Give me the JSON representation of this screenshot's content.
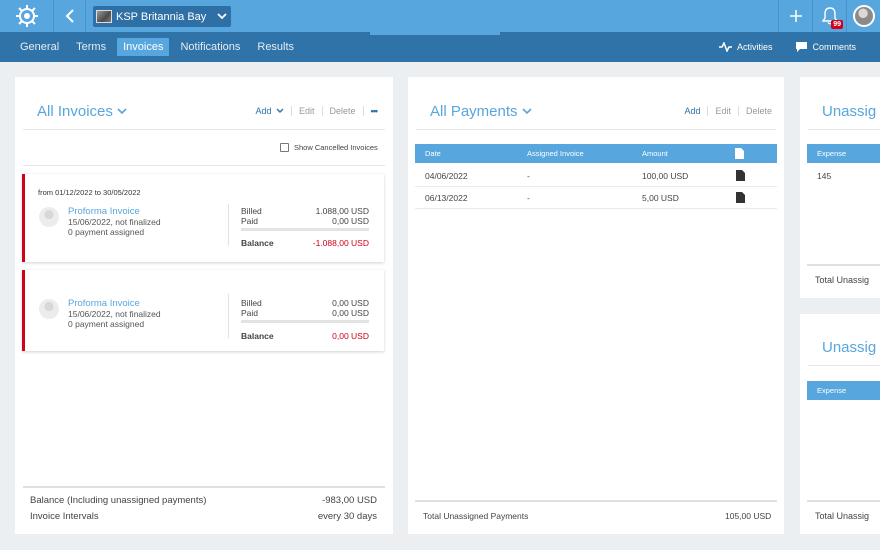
{
  "header": {
    "vessel_name": "KSP Britannia Bay",
    "notification_count": "99"
  },
  "nav": {
    "tabs": [
      {
        "label": "General"
      },
      {
        "label": "Terms"
      },
      {
        "label": "Invoices",
        "active": true
      },
      {
        "label": "Notifications"
      },
      {
        "label": "Results"
      }
    ],
    "activities_label": "Activities",
    "comments_label": "Comments"
  },
  "invoices_panel": {
    "title": "All Invoices",
    "add_label": "Add",
    "edit_label": "Edit",
    "delete_label": "Delete",
    "more_label": "•••",
    "show_cancelled_label": "Show Cancelled Invoices",
    "cards": [
      {
        "range": "from 01/12/2022 to 30/05/2022",
        "title": "Proforma Invoice",
        "date_status": "15/06/2022, not finalized",
        "payments": "0 payment assigned",
        "billed_label": "Billed",
        "billed": "1.088,00 USD",
        "paid_label": "Paid",
        "paid": "0,00 USD",
        "balance_label": "Balance",
        "balance": "-1.088,00 USD"
      },
      {
        "range": "",
        "title": "Proforma Invoice",
        "date_status": "15/06/2022, not finalized",
        "payments": "0 payment assigned",
        "billed_label": "Billed",
        "billed": "0,00 USD",
        "paid_label": "Paid",
        "paid": "0,00 USD",
        "balance_label": "Balance",
        "balance": "0,00 USD"
      }
    ],
    "footer": {
      "balance_label": "Balance (Including unassigned payments)",
      "balance_value": "-983,00 USD",
      "intervals_label": "Invoice Intervals",
      "intervals_value": "every 30 days"
    }
  },
  "payments_panel": {
    "title": "All Payments",
    "add_label": "Add",
    "edit_label": "Edit",
    "delete_label": "Delete",
    "columns": [
      "Date",
      "Assigned Invoice",
      "Amount"
    ],
    "rows": [
      {
        "date": "04/06/2022",
        "invoice": "-",
        "amount": "100,00 USD"
      },
      {
        "date": "06/13/2022",
        "invoice": "-",
        "amount": "5,00 USD"
      }
    ],
    "footer_label": "Total Unassigned Payments",
    "footer_value": "105,00 USD"
  },
  "unassigned_panel_1": {
    "title": "Unassig",
    "column": "Expense",
    "value": "145",
    "footer_label": "Total Unassig"
  },
  "unassigned_panel_2": {
    "title": "Unassig",
    "column": "Expense",
    "footer_label": "Total Unassig"
  },
  "colors": {
    "topbar": "#58a6de",
    "navbar": "#2f73a8",
    "accent": "#58a6de",
    "danger": "#d0021b"
  }
}
